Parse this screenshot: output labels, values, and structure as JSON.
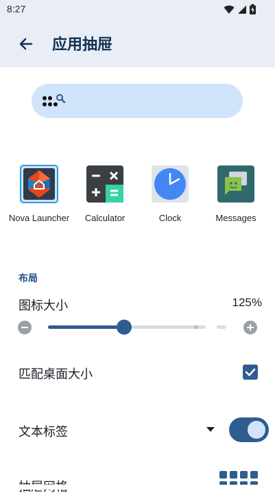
{
  "status_bar": {
    "time": "8:27"
  },
  "header": {
    "title": "应用抽屉"
  },
  "apps": [
    {
      "label": "Nova Launcher"
    },
    {
      "label": "Calculator"
    },
    {
      "label": "Clock"
    },
    {
      "label": "Messages"
    }
  ],
  "layout_section": {
    "heading": "布局",
    "icon_size": {
      "label": "图标大小",
      "value_text": "125%",
      "value_percent": 125
    },
    "match_desktop": {
      "label": "匹配桌面大小",
      "checked": true
    },
    "text_labels": {
      "label": "文本标签",
      "enabled": true
    },
    "drawer_grid": {
      "label": "抽屉网格"
    }
  },
  "colors": {
    "appbar_bg": "#e9edf6",
    "accent": "#2f5d8f",
    "search_bg": "#d2e4fb",
    "section_heading": "#1f4f82"
  }
}
